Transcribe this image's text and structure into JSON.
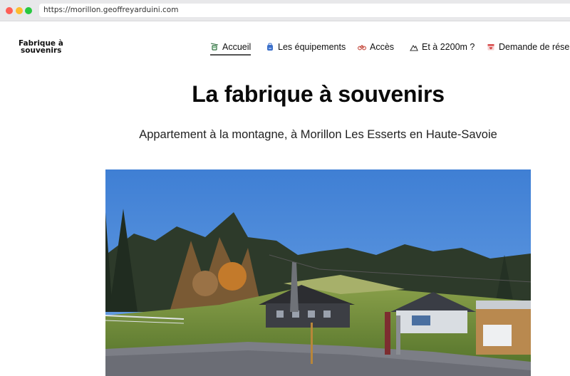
{
  "browser": {
    "url": "https://morillon.geoffreyarduini.com"
  },
  "site": {
    "logo_line1": "Fabrique à",
    "logo_line2": "souvenirs"
  },
  "nav": {
    "items": [
      {
        "label": "Accueil",
        "icon": "cable-car-icon",
        "active": true
      },
      {
        "label": "Les équipements",
        "icon": "backpack-icon",
        "active": false
      },
      {
        "label": "Accès",
        "icon": "bicycle-icon",
        "active": false
      },
      {
        "label": "Et à 2200m ?",
        "icon": "mountain-icon",
        "active": false
      },
      {
        "label": "Demande de réserv",
        "icon": "heart-calendar-icon",
        "active": false
      }
    ]
  },
  "main": {
    "title": "La fabrique à souvenirs",
    "subtitle": "Appartement à la montagne, à Morillon Les Esserts en Haute-Savoie"
  },
  "colors": {
    "sky": "#4a86d6",
    "grass": "#6d8f3a",
    "forest": "#2d3a2a",
    "chalet": "#3c3e44"
  }
}
